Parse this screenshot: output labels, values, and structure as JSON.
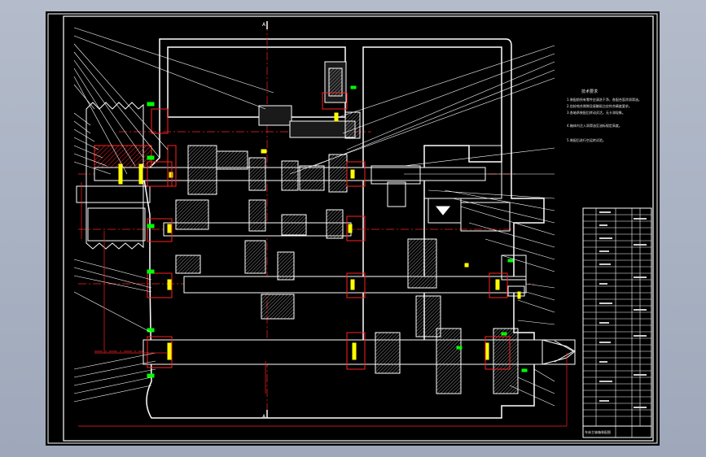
{
  "drawing": {
    "section_marks": {
      "top": "A",
      "bottom": "A"
    },
    "notes": {
      "title": "技术要求",
      "lines": [
        "1.装配前所有零件应清洗干净，各配合面涂润滑油。",
        "2.齿轮啮合侧隙及接触斑点应符合精度要求。",
        "3.各轴承装配后转动灵活，无卡滞现象。",
        "4.箱体内注入润滑油至油标规定高度。",
        "5.装配后进行空运转试验。"
      ]
    },
    "title_block": {
      "label": "车床主轴箱装配图"
    },
    "colors": {
      "background": "#000000",
      "housing": "#ffffff",
      "center_lines": "#ff2020",
      "leaders": "#ffffff",
      "hatch": "#ff2020",
      "bearing": "#ffff00",
      "fastener": "#00ff00",
      "frame": "#ffffff"
    }
  }
}
